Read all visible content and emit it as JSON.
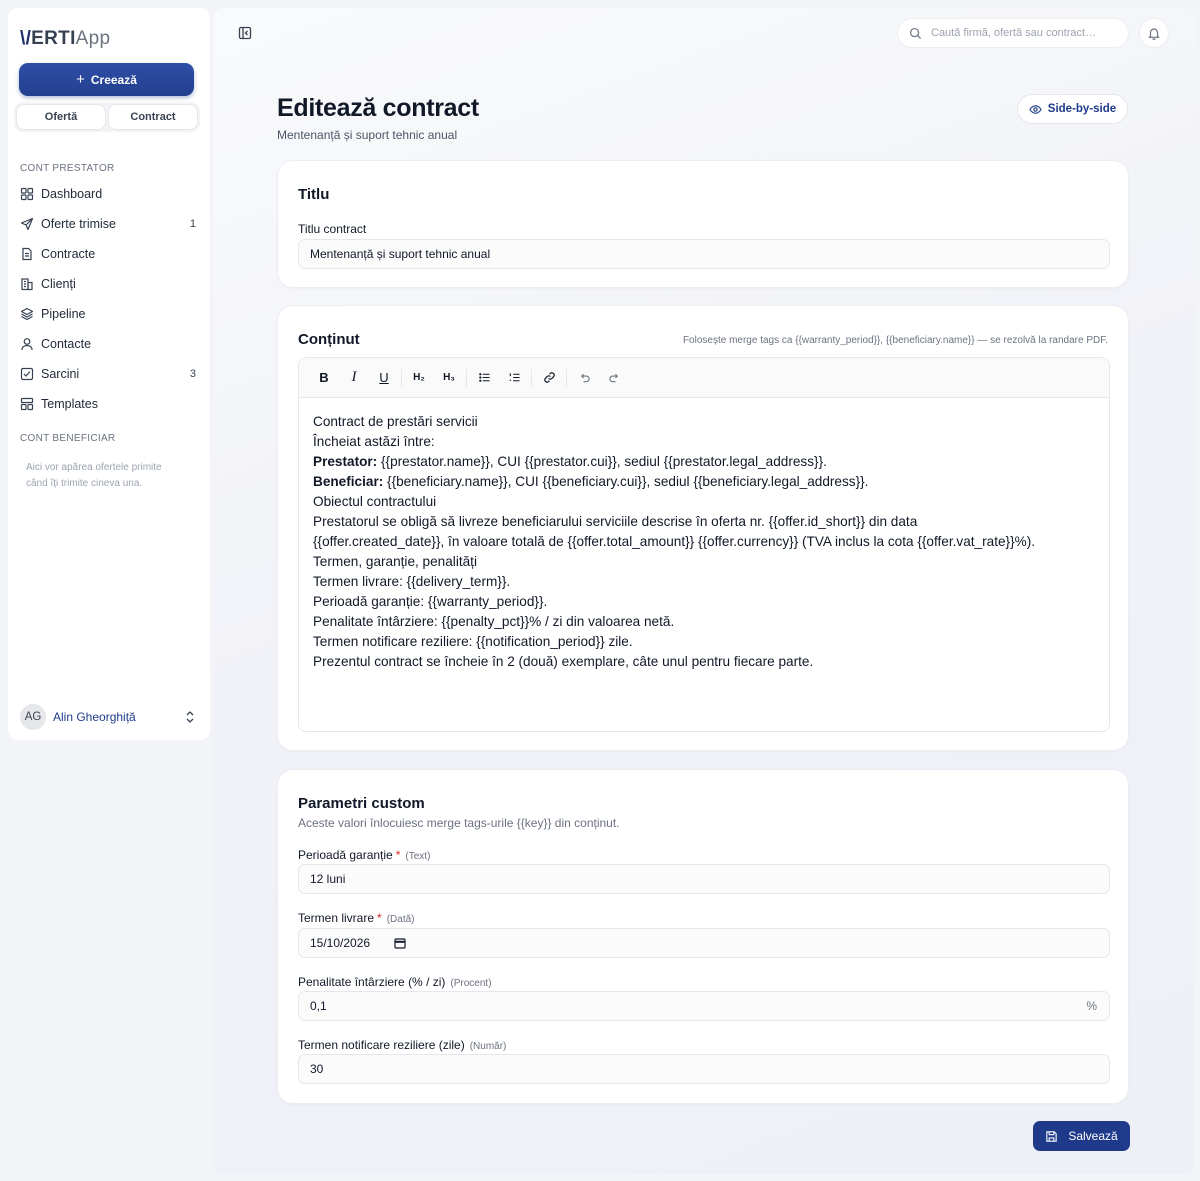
{
  "app": {
    "logo_part1": "\\/",
    "logo_part2": "ERTI",
    "logo_part3": "App"
  },
  "sidebar": {
    "create_label": "Creează",
    "sub_buttons": [
      "Ofertă",
      "Contract"
    ],
    "section_provider": "CONT PRESTATOR",
    "items": [
      {
        "label": "Dashboard",
        "icon": "dashboard-icon",
        "count": ""
      },
      {
        "label": "Oferte trimise",
        "icon": "send-icon",
        "count": "1"
      },
      {
        "label": "Contracte",
        "icon": "document-icon",
        "count": ""
      },
      {
        "label": "Clienți",
        "icon": "building-icon",
        "count": ""
      },
      {
        "label": "Pipeline",
        "icon": "layers-icon",
        "count": ""
      },
      {
        "label": "Contacte",
        "icon": "user-icon",
        "count": ""
      },
      {
        "label": "Sarcini",
        "icon": "checkbox-icon",
        "count": "3"
      },
      {
        "label": "Templates",
        "icon": "template-icon",
        "count": ""
      }
    ],
    "section_beneficiary": "CONT BENEFICIAR",
    "beneficiary_empty": "Aici vor apărea ofertele primite când îți trimite cineva una.",
    "user": {
      "initials": "AG",
      "name": "Alin Gheorghiță"
    }
  },
  "topbar": {
    "search_placeholder": "Caută firmă, ofertă sau contract…"
  },
  "page": {
    "title": "Editează contract",
    "subtitle": "Mentenanță și suport tehnic anual",
    "side_by_side_label": "Side-by-side"
  },
  "title_card": {
    "heading": "Titlu",
    "field_label": "Titlu contract",
    "field_value": "Mentenanță și suport tehnic anual"
  },
  "content_card": {
    "heading": "Conținut",
    "hint": "Folosește merge tags ca {{warranty_period}}, {{beneficiary.name}} — se rezolvă la randare PDF.",
    "toolbar": [
      "B",
      "I",
      "U",
      "H₂",
      "H₃"
    ],
    "lines": {
      "l1": "Contract de prestări servicii",
      "l2": "Încheiat astăzi între:",
      "l3_bold": "Prestator:",
      "l3_rest": " {{prestator.name}}, CUI {{prestator.cui}}, sediul {{prestator.legal_address}}.",
      "l4_bold": "Beneficiar:",
      "l4_rest": " {{beneficiary.name}}, CUI {{beneficiary.cui}}, sediul {{beneficiary.legal_address}}.",
      "l5": "Obiectul contractului",
      "l6": "Prestatorul se obligă să livreze beneficiarului serviciile descrise în oferta nr. {{offer.id_short}} din data",
      "l7": "{{offer.created_date}}, în valoare totală de {{offer.total_amount}} {{offer.currency}} (TVA inclus la cota {{offer.vat_rate}}%).",
      "l8": "Termen, garanție, penalități",
      "l9": "Termen livrare: {{delivery_term}}.",
      "l10": "Perioadă garanție: {{warranty_period}}.",
      "l11": "Penalitate întârziere: {{penalty_pct}}% / zi din valoarea netă.",
      "l12": "Termen notificare reziliere: {{notification_period}} zile.",
      "l13": "Prezentul contract se încheie în 2 (două) exemplare, câte unul pentru fiecare parte."
    }
  },
  "params_card": {
    "heading": "Parametri custom",
    "description": "Aceste valori înlocuiesc merge tags-urile {{key}} din conținut.",
    "fields": [
      {
        "label": "Perioadă garanție",
        "required": "*",
        "type": "(Text)",
        "value": "12 luni",
        "suffix": ""
      },
      {
        "label": "Termen livrare",
        "required": "*",
        "type": "(Dată)",
        "value": "15/10/2026",
        "suffix": ""
      },
      {
        "label": "Penalitate întârziere (% / zi)",
        "required": "",
        "type": "(Procent)",
        "value": "0,1",
        "suffix": "%"
      },
      {
        "label": "Termen notificare reziliere (zile)",
        "required": "",
        "type": "(Număr)",
        "value": "30",
        "suffix": ""
      }
    ]
  },
  "save_label": "Salvează",
  "colors": {
    "primary": "#233f8f",
    "required": "#dc2626"
  }
}
